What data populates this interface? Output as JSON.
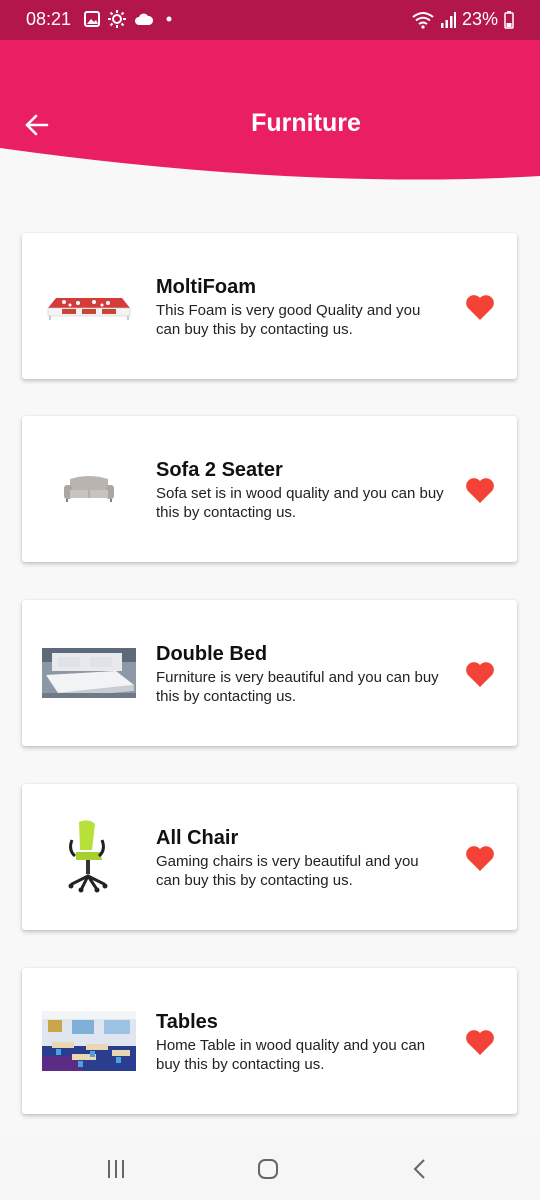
{
  "status_bar": {
    "time": "08:21",
    "battery": "23%",
    "icons": [
      "gallery-icon",
      "brightness-icon",
      "cloud-icon",
      "notification-dot-icon",
      "wifi-icon",
      "signal-icon",
      "battery-icon"
    ]
  },
  "header": {
    "title": "Furniture",
    "back_icon": "arrow-left-icon",
    "color": "#e91e63"
  },
  "items": [
    {
      "name": "MoltiFoam",
      "description": "This Foam is very good Quality and you can buy this by contacting us.",
      "image": "foam-mattress",
      "favorite": true
    },
    {
      "name": "Sofa 2 Seater",
      "description": "Sofa set is in wood quality  and you can buy this by contacting us.",
      "image": "sofa",
      "favorite": true
    },
    {
      "name": "Double Bed",
      "description": "Furniture is very beautiful  and you can buy this by contacting us.",
      "image": "bed",
      "favorite": true
    },
    {
      "name": "All Chair",
      "description": "Gaming chairs is very beautiful  and you can buy this by contacting us.",
      "image": "office-chair",
      "favorite": true
    },
    {
      "name": "Tables",
      "description": "Home Table in wood quality  and you can buy this by contacting us.",
      "image": "classroom-tables",
      "favorite": true
    }
  ],
  "favorite_color": "#f44336",
  "nav_bar": [
    "recent-apps-icon",
    "home-icon",
    "back-icon"
  ]
}
